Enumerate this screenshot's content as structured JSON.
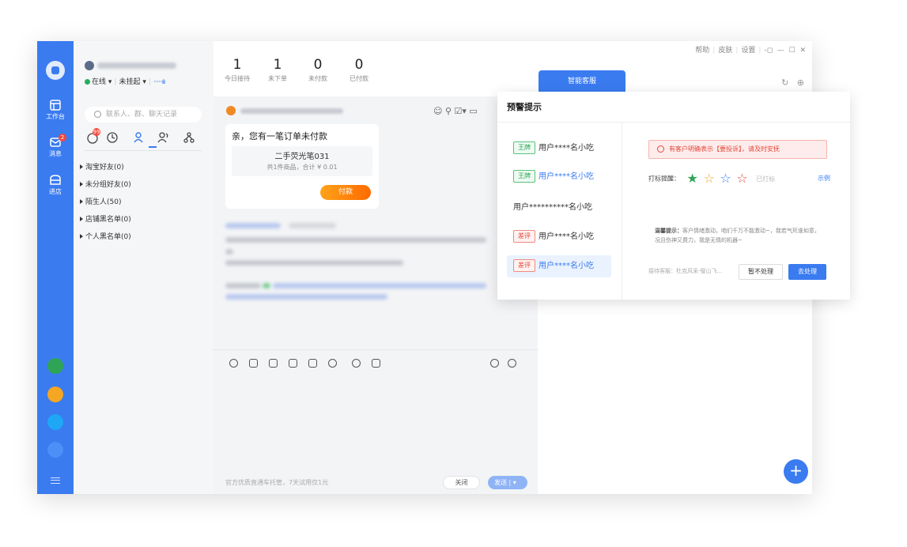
{
  "nav": {
    "items": [
      {
        "label": "工作台",
        "icon": "workbench-icon"
      },
      {
        "label": "消息",
        "icon": "message-icon",
        "badge": "2"
      },
      {
        "label": "进店",
        "icon": "shop-icon"
      }
    ],
    "bottom_apps": [
      "team-icon",
      "store-app-icon",
      "robot-icon",
      "chat-bubble-icon"
    ]
  },
  "profile": {
    "status": "在线",
    "hang": "未挂起"
  },
  "contacts": {
    "search_placeholder": "联系人、群、聊天记录",
    "tab_badge": "99",
    "groups": [
      "淘宝好友(0)",
      "未分组好友(0)",
      "陌生人(50)",
      "店铺黑名单(0)",
      "个人黑名单(0)"
    ]
  },
  "stats": [
    {
      "num": "1",
      "label": "今日接待"
    },
    {
      "num": "1",
      "label": "未下单"
    },
    {
      "num": "0",
      "label": "未付款"
    },
    {
      "num": "0",
      "label": "已付款"
    }
  ],
  "chat": {
    "order_title": "亲，您有一笔订单未付款",
    "product_name": "二手荧光笔031",
    "product_summary": "共1件商品，合计 ¥ 0.01",
    "pay_label": "付款",
    "footer_hint": "官方优质直通车托管，7天试用仅1元",
    "close_label": "关闭",
    "send_label": "发送"
  },
  "window": {
    "menu": [
      "帮助",
      "皮肤",
      "设置"
    ],
    "ai_tab": "智能客服"
  },
  "popup": {
    "title": "预警提示",
    "users": [
      {
        "tag": "王牌",
        "tag_color": "green",
        "name": "用户****名小吃",
        "highlight": false
      },
      {
        "tag": "王牌",
        "tag_color": "green",
        "name": "用户****名小吃",
        "highlight": true
      },
      {
        "tag": "",
        "tag_color": "",
        "name": "用户**********名小吃",
        "highlight": false
      },
      {
        "tag": "差评",
        "tag_color": "red",
        "name": "用户****名小吃",
        "highlight": false
      },
      {
        "tag": "差评",
        "tag_color": "red",
        "name": "用户****名小吃",
        "highlight": true
      }
    ],
    "alert": "有客户明确表示【要投诉】，请及时安抚",
    "rating_label": "打标提醒：",
    "rating_done": "已打标",
    "rating_example": "示例",
    "stars": [
      "#2fa456",
      "#f5a623",
      "#3a7bf0",
      "#e8473a"
    ],
    "tip_title": "温馨提示：",
    "tip_text": "客户情绪激动，咱们千万不能激动~，我若气死谁如意，况且伤神又费力，我是无情的机器~",
    "agent": "接待客服：杜克风采-璧山飞...",
    "btn_later": "暂不处理",
    "btn_go": "去处理"
  }
}
